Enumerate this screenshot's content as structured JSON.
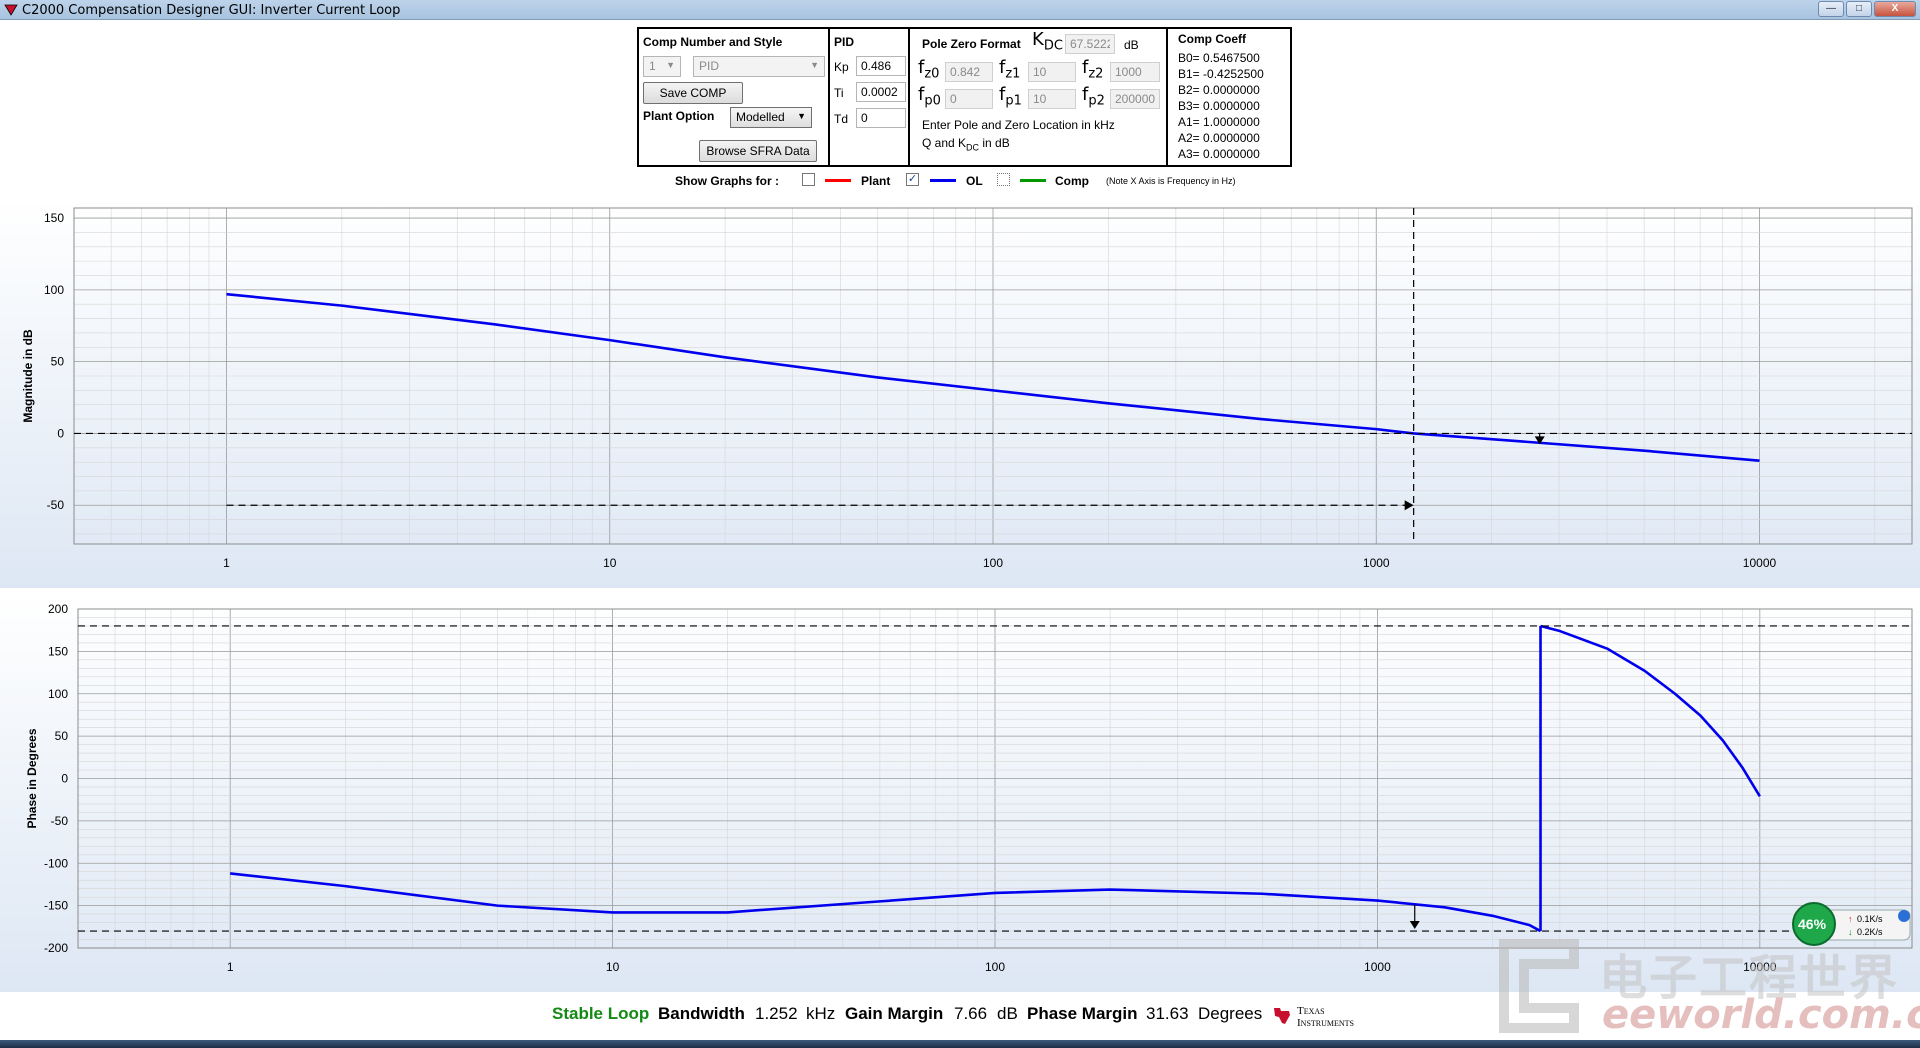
{
  "window": {
    "title": "C2000 Compensation Designer GUI: Inverter Current Loop",
    "buttons": {
      "minimize": "—",
      "maximize": "□",
      "close": "X"
    }
  },
  "comp_panel": {
    "title": "Comp Number and Style",
    "comp_number": "1",
    "comp_style": "PID",
    "save_label": "Save COMP",
    "plant_option_label": "Plant Option",
    "plant_option_value": "Modelled",
    "browse_label": "Browse SFRA Data"
  },
  "pid_panel": {
    "title": "PID",
    "kp_label": "Kp",
    "kp_value": "0.486",
    "ti_label": "Ti",
    "ti_value": "0.0002",
    "td_label": "Td",
    "td_value": "0"
  },
  "pz_panel": {
    "title": "Pole Zero Format",
    "kdc_symbol": "K",
    "kdc_sub": "DC",
    "kdc_value": "67.5222",
    "kdc_unit": "dB",
    "f_symbol": "f",
    "fz0_sub": "z0",
    "fz0_value": "0.842",
    "fz1_sub": "z1",
    "fz1_value": "10",
    "fz2_sub": "z2",
    "fz2_value": "1000",
    "fp0_sub": "p0",
    "fp0_value": "0",
    "fp1_sub": "p1",
    "fp1_value": "10",
    "fp2_sub": "p2",
    "fp2_value": "200000",
    "hint_line1": "Enter Pole and Zero Location in kHz",
    "hint_line2_pre": "Q and K",
    "hint_line2_sub": "DC",
    "hint_line2_post": " in dB"
  },
  "coeff_panel": {
    "title": "Comp Coeff",
    "coeffs": [
      "B0= 0.5467500",
      "B1= -0.4252500",
      "B2= 0.0000000",
      "B3= 0.0000000",
      "A1= 1.0000000",
      "A2= 0.0000000",
      "A3= 0.0000000"
    ]
  },
  "show_graphs": {
    "label": "Show Graphs for :",
    "items": [
      {
        "name": "Plant",
        "checked": false,
        "color": "#ff0000"
      },
      {
        "name": "OL",
        "checked": true,
        "color": "#0000ee"
      },
      {
        "name": "Comp",
        "checked": false,
        "color": "#009900"
      }
    ],
    "note": "(Note X Axis is Frequency in Hz)"
  },
  "status": {
    "stable": "Stable Loop",
    "bandwidth_label": "Bandwidth",
    "bandwidth_value": "1.252",
    "bandwidth_unit": "kHz",
    "gain_margin_label": "Gain Margin",
    "gain_margin_value": "7.66",
    "gain_margin_unit": "dB",
    "phase_margin_label": "Phase Margin",
    "phase_margin_value": "31.63",
    "phase_margin_unit": "Degrees",
    "brand_line1": "Texas",
    "brand_line2": "Instruments"
  },
  "net_widget": {
    "percent": "46%",
    "up": "0.1K/s",
    "down": "0.2K/s"
  },
  "watermark": {
    "cn": "电子工程世界",
    "url": "eeworld.com.cn"
  },
  "chart_data": [
    {
      "type": "line",
      "ylabel": "Magnitude in dB",
      "xscale": "log",
      "xlim": [
        0.4,
        25000
      ],
      "ylim": [
        -77,
        157
      ],
      "xticks": [
        "1",
        "10",
        "100",
        "1000",
        "10000"
      ],
      "yticks": [
        "150",
        "100",
        "50",
        "0",
        "-50"
      ],
      "grid": true,
      "series": [
        {
          "color": "#0000ee",
          "x": [
            1,
            2,
            5,
            10,
            20,
            50,
            100,
            200,
            500,
            1000,
            1252,
            2000,
            5000,
            10000
          ],
          "y": [
            97,
            89,
            76,
            65,
            53,
            39,
            30,
            21,
            10,
            3,
            0,
            -4,
            -12,
            -19
          ]
        }
      ],
      "annotations": {
        "zero_line": 0,
        "crossover_freq": 1252,
        "gm_marker_freq": 2670,
        "gm_arrow_y": -50
      }
    },
    {
      "type": "line",
      "ylabel": "Phase in Degrees",
      "xscale": "log",
      "xlim": [
        0.4,
        25000
      ],
      "ylim": [
        -200,
        200
      ],
      "xticks": [
        "1",
        "10",
        "100",
        "1000",
        "10000"
      ],
      "yticks": [
        "200",
        "150",
        "100",
        "50",
        "0",
        "-50",
        "-100",
        "-150",
        "-200"
      ],
      "grid": true,
      "series": [
        {
          "color": "#0000ee",
          "x": [
            1,
            2,
            5,
            10,
            20,
            50,
            100,
            200,
            500,
            1000,
            1500,
            2000,
            2500,
            2670
          ],
          "y": [
            -112,
            -127,
            -150,
            -158,
            -158,
            -145,
            -135,
            -131,
            -136,
            -144,
            -152,
            -162,
            -173,
            -180
          ]
        },
        {
          "color": "#0000ee",
          "x": [
            2670,
            3000,
            4000,
            5000,
            6000,
            7000,
            8000,
            9000,
            10000
          ],
          "y": [
            180,
            174,
            153,
            127,
            100,
            74,
            45,
            13,
            -21
          ]
        }
      ],
      "annotations": {
        "ref_lines": [
          180,
          -180
        ],
        "crossover_freq": 1252,
        "crossover_phase": -148.37
      }
    }
  ]
}
